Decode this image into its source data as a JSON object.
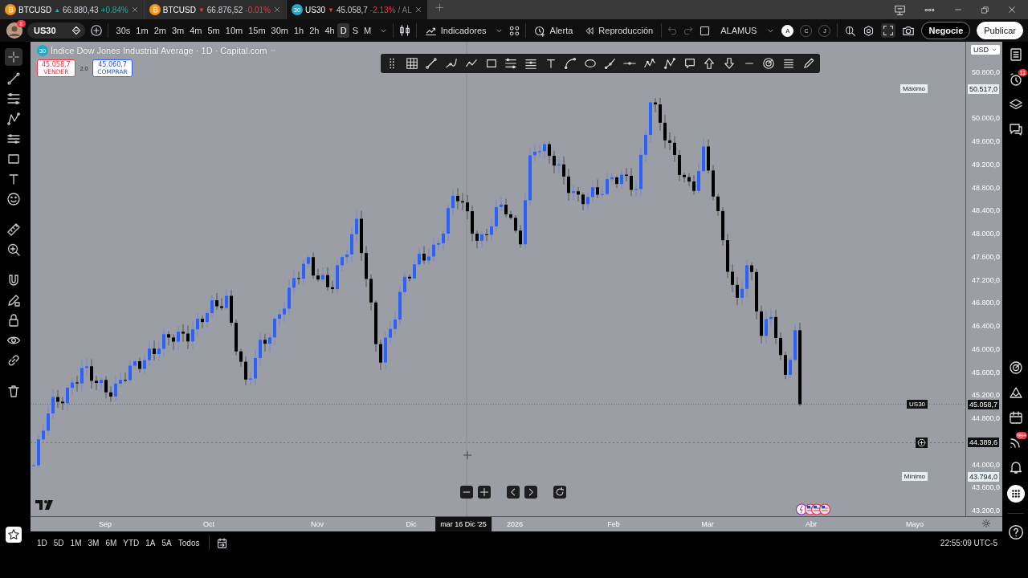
{
  "tabs": [
    {
      "symbol": "BTCUSD",
      "arrow": "▲",
      "price": "66.880,43",
      "change": "+0.84%",
      "color": "#26a69a",
      "selected": false
    },
    {
      "symbol": "BTCUSD",
      "arrow": "▼",
      "price": "66.876,52",
      "change": "-0.01%",
      "color": "#f23645",
      "selected": false
    },
    {
      "symbol": "US30",
      "badge": "30",
      "arrow": "▼",
      "price": "45.058,7",
      "change": "-2.13%",
      "suffix": "/ AL",
      "color": "#f23645",
      "selected": true
    }
  ],
  "user": {
    "badge": "8"
  },
  "toolbar": {
    "symbol": "US30",
    "intervals": [
      {
        "label": "30s",
        "selected": false
      },
      {
        "label": "1m",
        "selected": false
      },
      {
        "label": "2m",
        "selected": false
      },
      {
        "label": "3m",
        "selected": false
      },
      {
        "label": "4m",
        "selected": false
      },
      {
        "label": "5m",
        "selected": false
      },
      {
        "label": "10m",
        "selected": false
      },
      {
        "label": "15m",
        "selected": false
      },
      {
        "label": "30m",
        "selected": false
      },
      {
        "label": "1h",
        "selected": false
      },
      {
        "label": "2h",
        "selected": false
      },
      {
        "label": "4h",
        "selected": false
      },
      {
        "label": "D",
        "selected": true
      },
      {
        "label": "S",
        "selected": false
      },
      {
        "label": "M",
        "selected": false
      }
    ],
    "indicators": "Indicadores",
    "alert": "Alerta",
    "replay": "Reproducción",
    "layout_name": "ALAMUS",
    "layout_buttons": [
      {
        "label": "A",
        "selected": true
      },
      {
        "label": "C",
        "selected": false
      },
      {
        "label": "J",
        "selected": false
      }
    ],
    "trade": "Negocie",
    "publish": "Publicar"
  },
  "chart": {
    "symbol_badge": "30",
    "title": "Índice Dow Jones Industrial Average · 1D · Capital.com",
    "sell": {
      "price": "45.058,7",
      "label": "VENDER"
    },
    "spread": "2.0",
    "buy": {
      "price": "45.060,7",
      "label": "COMPRAR"
    },
    "currency": "USD",
    "price_ticks": [
      "50.800,0",
      "50.000,0",
      "49.600,0",
      "49.200,0",
      "48.800,0",
      "48.400,0",
      "48.000,0",
      "47.600,0",
      "47.200,0",
      "46.800,0",
      "46.400,0",
      "46.000,0",
      "45.600,0",
      "45.200,0",
      "44.800,0",
      "44.000,0",
      "43.600,0",
      "43.200,0"
    ],
    "high": {
      "label": "Máximo",
      "price": "50.517,0"
    },
    "low": {
      "label": "Mínimo",
      "price": "43.794,0"
    },
    "last": {
      "symbol": "US30",
      "price": "45.058,7"
    },
    "crosshair": {
      "price": "44.389,6",
      "date": "mar 16 Dic '25"
    },
    "time_ticks": [
      "Sep",
      "Oct",
      "Nov",
      "Dic",
      "2026",
      "Feb",
      "Mar",
      "Abr",
      "Mayo"
    ]
  },
  "notifications": {
    "alerts": "11",
    "news": "99+"
  },
  "ranges": [
    "1D",
    "5D",
    "1M",
    "3M",
    "6M",
    "YTD",
    "1A",
    "5A",
    "Todos"
  ],
  "clock": "22:55:09 UTC-5"
}
